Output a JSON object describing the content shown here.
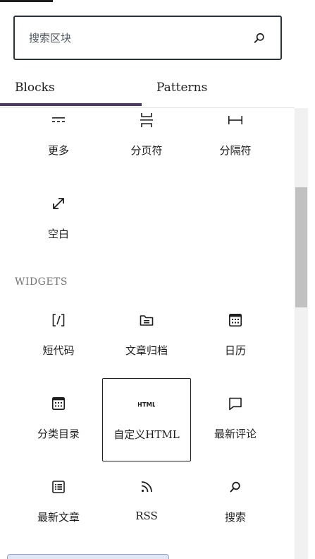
{
  "search": {
    "placeholder": "搜索区块"
  },
  "tabs": [
    {
      "label": "Blocks",
      "active": true
    },
    {
      "label": "Patterns",
      "active": false
    }
  ],
  "colors": {
    "accent": "#4b3a62",
    "text": "#1e1e1e",
    "muted": "#757575",
    "border": "#2c3338"
  },
  "design_blocks": [
    {
      "label": "更多",
      "icon": "more-icon"
    },
    {
      "label": "分页符",
      "icon": "page-break-icon"
    },
    {
      "label": "分隔符",
      "icon": "separator-icon"
    },
    {
      "label": "空白",
      "icon": "spacer-icon"
    }
  ],
  "widgets": {
    "title": "WIDGETS",
    "blocks": [
      {
        "label": "短代码",
        "icon": "shortcode-icon"
      },
      {
        "label": "文章归档",
        "icon": "archive-icon"
      },
      {
        "label": "日历",
        "icon": "calendar-icon"
      },
      {
        "label": "分类目录",
        "icon": "categories-icon"
      },
      {
        "label": "自定义HTML",
        "icon": "html-icon",
        "icon_text": "HTML",
        "selected": true
      },
      {
        "label": "最新评论",
        "icon": "comment-icon"
      },
      {
        "label": "最新文章",
        "icon": "list-icon"
      },
      {
        "label": "RSS",
        "icon": "rss-icon"
      },
      {
        "label": "搜索",
        "icon": "search-icon"
      }
    ]
  }
}
